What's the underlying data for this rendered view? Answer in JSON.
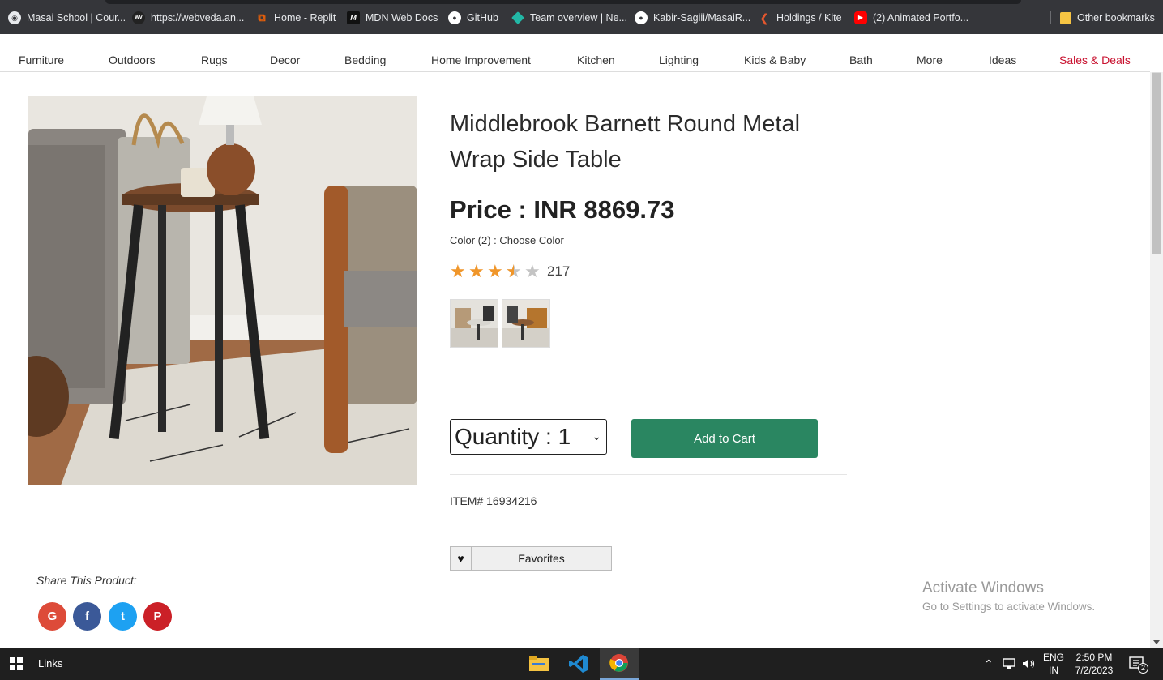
{
  "bookmarks": [
    {
      "label": "Masai School | Cour...",
      "icon": "globe-icon",
      "color": "#dddddd"
    },
    {
      "label": "https://webveda.an...",
      "icon": "webveda-icon",
      "color": "#333333"
    },
    {
      "label": "Home - Replit",
      "icon": "replit-icon",
      "color": "#f26207"
    },
    {
      "label": "MDN Web Docs",
      "icon": "mdn-icon",
      "color": "#111111"
    },
    {
      "label": "GitHub",
      "icon": "github-icon",
      "color": "#ffffff"
    },
    {
      "label": "Team overview | Ne...",
      "icon": "netlify-icon",
      "color": "#22b8a6"
    },
    {
      "label": "Kabir-Sagiii/MasaiR...",
      "icon": "github-icon",
      "color": "#ffffff"
    },
    {
      "label": "Holdings / Kite",
      "icon": "kite-icon",
      "color": "#e4572e"
    },
    {
      "label": "(2) Animated Portfo...",
      "icon": "youtube-icon",
      "color": "#ff0000"
    }
  ],
  "other_bookmarks": "Other bookmarks",
  "categories": [
    "Furniture",
    "Outdoors",
    "Rugs",
    "Decor",
    "Bedding",
    "Home Improvement",
    "Kitchen",
    "Lighting",
    "Kids & Baby",
    "Bath",
    "More",
    "Ideas",
    "Sales & Deals"
  ],
  "product": {
    "title": "Middlebrook Barnett Round Metal Wrap Side Table",
    "price": "Price : INR 8869.73",
    "color_line": "Color (2) : Choose Color",
    "rating": 3.5,
    "rating_max": 5,
    "review_count": "217",
    "quantity": "Quantity : 1",
    "add_to_cart": "Add to Cart",
    "item_number": "ITEM# 16934216",
    "favorites": "Favorites"
  },
  "share": {
    "title": "Share This Product:",
    "networks": [
      {
        "name": "google",
        "glyph": "G",
        "color": "#dd4b39"
      },
      {
        "name": "facebook",
        "glyph": "f",
        "color": "#3b5998"
      },
      {
        "name": "twitter",
        "glyph": "t",
        "color": "#1da1f2"
      },
      {
        "name": "pinterest",
        "glyph": "P",
        "color": "#cb2027"
      }
    ]
  },
  "watermark": {
    "title": "Activate Windows",
    "subtitle": "Go to Settings to activate Windows."
  },
  "taskbar": {
    "links": "Links",
    "lang_1": "ENG",
    "lang_2": "IN",
    "time": "2:50 PM",
    "date": "7/2/2023",
    "notifications": "2"
  },
  "colors": {
    "accent_green": "#2a8661",
    "sale_red": "#c8102e",
    "star_orange": "#f0962a"
  }
}
